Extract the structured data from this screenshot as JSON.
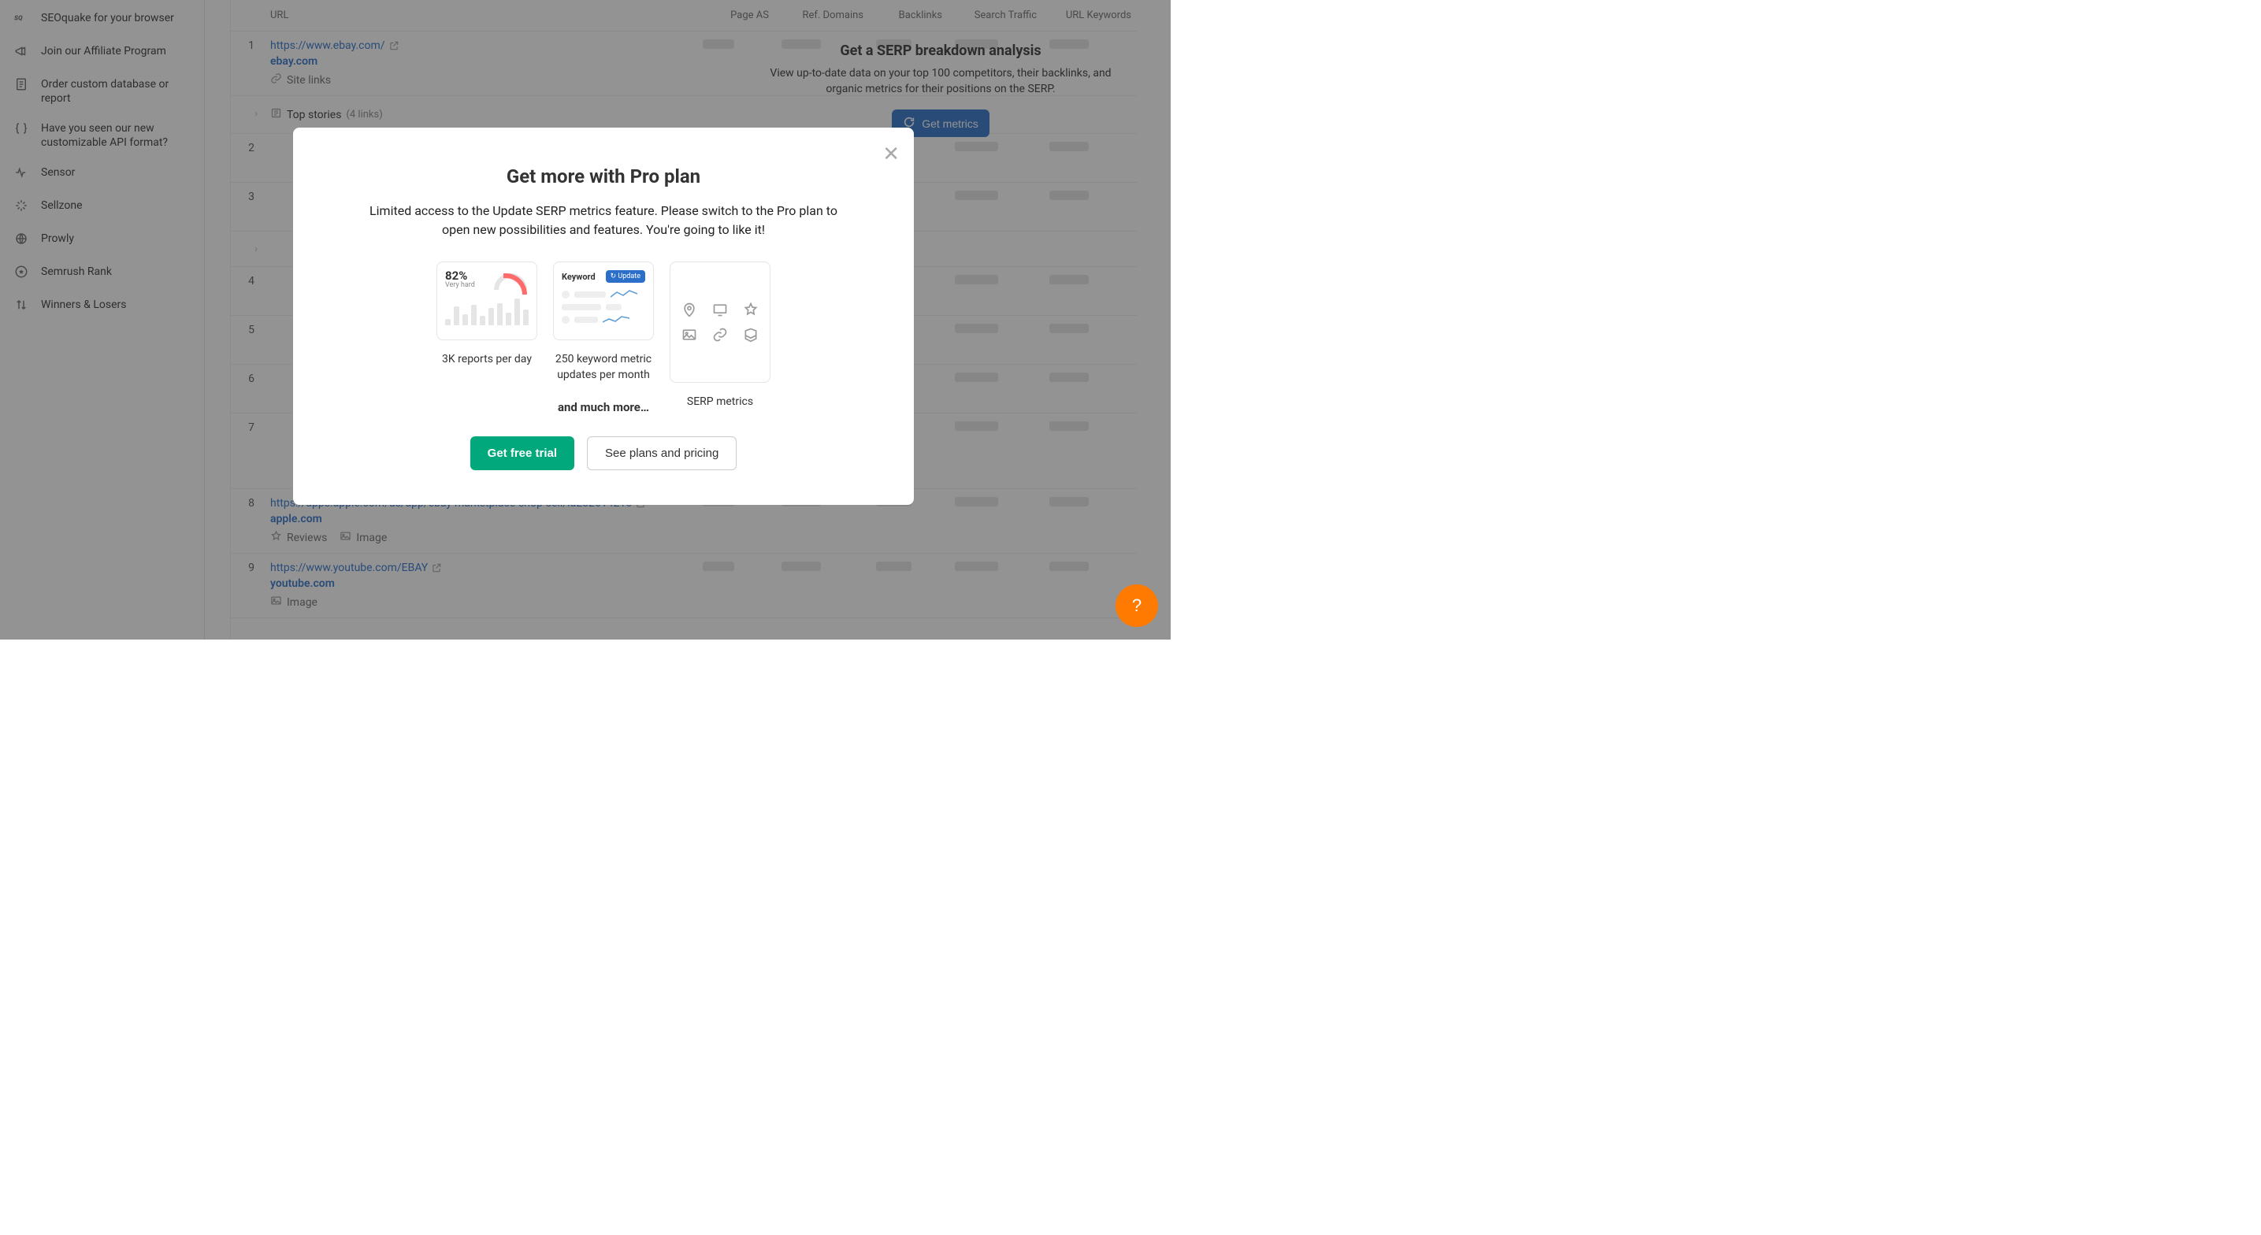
{
  "sidebar": {
    "items": [
      {
        "label": "SEOquake for your browser"
      },
      {
        "label": "Join our Affiliate Program"
      },
      {
        "label": "Order custom database or report"
      },
      {
        "label": "Have you seen our new customizable API format?"
      },
      {
        "label": "Sensor"
      },
      {
        "label": "Sellzone"
      },
      {
        "label": "Prowly"
      },
      {
        "label": "Semrush Rank"
      },
      {
        "label": "Winners & Losers"
      }
    ]
  },
  "table": {
    "headers": {
      "url": "URL",
      "page_as": "Page AS",
      "ref_domains": "Ref. Domains",
      "backlinks": "Backlinks",
      "search_traffic": "Search Traffic",
      "url_keywords": "URL Keywords"
    },
    "rows": [
      {
        "idx": "1",
        "url": "https://www.ebay.com/",
        "domain": "ebay.com",
        "tags": [
          {
            "icon": "link",
            "label": "Site links"
          }
        ]
      },
      {
        "special": true,
        "label": "Top stories",
        "count": "(4 links)"
      },
      {
        "idx": "2",
        "blank": true
      },
      {
        "idx": "3",
        "blank": true
      },
      {
        "special": true,
        "empty": true
      },
      {
        "idx": "4",
        "blank": true
      },
      {
        "idx": "5",
        "blank": true
      },
      {
        "idx": "6",
        "blank": true
      },
      {
        "idx": "7",
        "blank": true,
        "tall": true
      },
      {
        "idx": "8",
        "url": "https://apps.apple.com/us/app/ebay-marketplace-shop-sell/id282614216",
        "domain": "apple.com",
        "tags": [
          {
            "icon": "star",
            "label": "Reviews"
          },
          {
            "icon": "image",
            "label": "Image"
          }
        ]
      },
      {
        "idx": "9",
        "url": "https://www.youtube.com/EBAY",
        "domain": "youtube.com",
        "tags": [
          {
            "icon": "image",
            "label": "Image"
          }
        ]
      }
    ]
  },
  "metrics_panel": {
    "title": "Get a SERP breakdown analysis",
    "desc": "View up-to-date data on your top 100 competitors, their backlinks, and organic metrics for their positions on the SERP.",
    "button": "Get metrics"
  },
  "modal": {
    "title": "Get more with Pro plan",
    "desc": "Limited access to the Update SERP metrics feature. Please switch to the Pro plan to open new possibilities and features. You're going to like it!",
    "features": [
      {
        "caption": "3K reports per day"
      },
      {
        "caption": "250 keyword metric updates per month"
      },
      {
        "caption": "SERP metrics"
      }
    ],
    "card_chart": {
      "percent": "82%",
      "percent_sub": "Very hard"
    },
    "card_kw": {
      "keyword_label": "Keyword",
      "update_label": "↻ Update"
    },
    "more": "and much more…",
    "primary": "Get free trial",
    "secondary": "See plans and pricing"
  }
}
